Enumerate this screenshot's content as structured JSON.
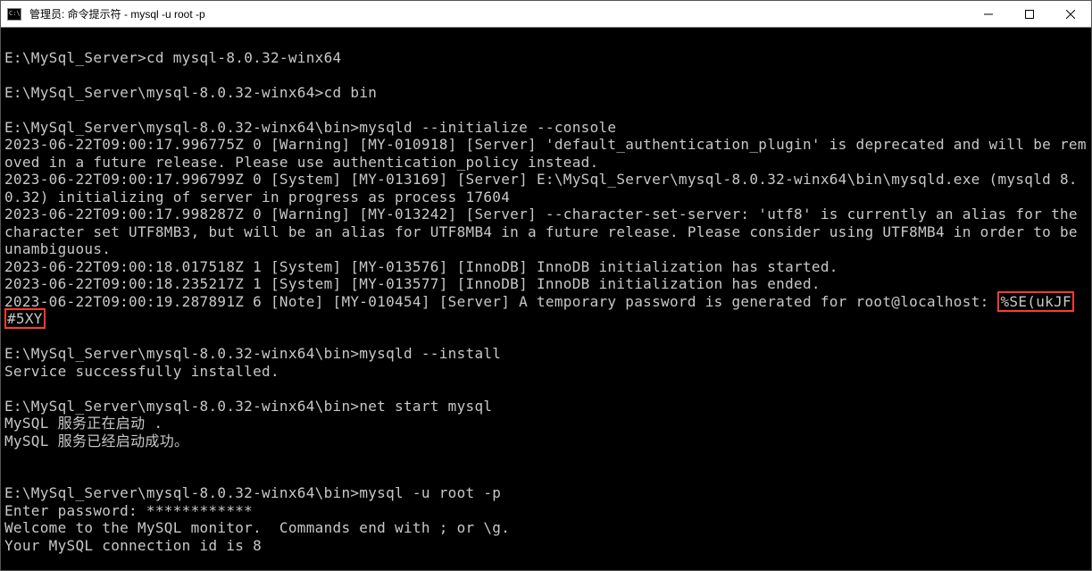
{
  "window": {
    "title": "管理员: 命令提示符 - mysql  -u root -p"
  },
  "lines": {
    "l1p": "E:\\MySql_Server>",
    "l1c": "cd mysql-8.0.32-winx64",
    "l2p": "E:\\MySql_Server\\mysql-8.0.32-winx64>",
    "l2c": "cd bin",
    "l3p": "E:\\MySql_Server\\mysql-8.0.32-winx64\\bin>",
    "l3c": "mysqld --initialize --console",
    "l4": "2023-06-22T09:00:17.996775Z 0 [Warning] [MY-010918] [Server] 'default_authentication_plugin' is deprecated and will be removed in a future release. Please use authentication_policy instead.",
    "l5": "2023-06-22T09:00:17.996799Z 0 [System] [MY-013169] [Server] E:\\MySql_Server\\mysql-8.0.32-winx64\\bin\\mysqld.exe (mysqld 8.0.32) initializing of server in progress as process 17604",
    "l6": "2023-06-22T09:00:17.998287Z 0 [Warning] [MY-013242] [Server] --character-set-server: 'utf8' is currently an alias for the character set UTF8MB3, but will be an alias for UTF8MB4 in a future release. Please consider using UTF8MB4 in order to be unambiguous.",
    "l7": "2023-06-22T09:00:18.017518Z 1 [System] [MY-013576] [InnoDB] InnoDB initialization has started.",
    "l8": "2023-06-22T09:00:18.235217Z 1 [System] [MY-013577] [InnoDB] InnoDB initialization has ended.",
    "l9a": "2023-06-22T09:00:19.287891Z 6 [Note] [MY-010454] [Server] A temporary password is generated for root@localhost: ",
    "l9b": "%SE(ukJF",
    "l9c": "#5XY",
    "l10p": "E:\\MySql_Server\\mysql-8.0.32-winx64\\bin>",
    "l10c": "mysqld --install",
    "l11": "Service successfully installed.",
    "l12p": "E:\\MySql_Server\\mysql-8.0.32-winx64\\bin>",
    "l12c": "net start mysql",
    "l13": "MySQL 服务正在启动 .",
    "l14": "MySQL 服务已经启动成功。",
    "l15p": "E:\\MySql_Server\\mysql-8.0.32-winx64\\bin>",
    "l15c": "mysql -u root -p",
    "l16": "Enter password: ************",
    "l17": "Welcome to the MySQL monitor.  Commands end with ; or \\g.",
    "l18": "Your MySQL connection id is 8"
  }
}
